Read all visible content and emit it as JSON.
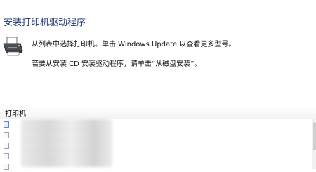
{
  "header": {
    "title": "安装打印机驱动程序",
    "icon": "printer-icon",
    "instruction_1": "从列表中选择打印机。单击 Windows Update 以查看更多型号。",
    "instruction_2": "若要从安装 CD 安装驱动程序，请单击“从磁盘安装”。"
  },
  "list": {
    "column_header": "打印机",
    "rows": [
      "",
      "",
      "",
      "",
      ""
    ],
    "selected_row": 0
  },
  "colors": {
    "title": "#1e3a6e",
    "selection_border": "#5b87c9"
  }
}
